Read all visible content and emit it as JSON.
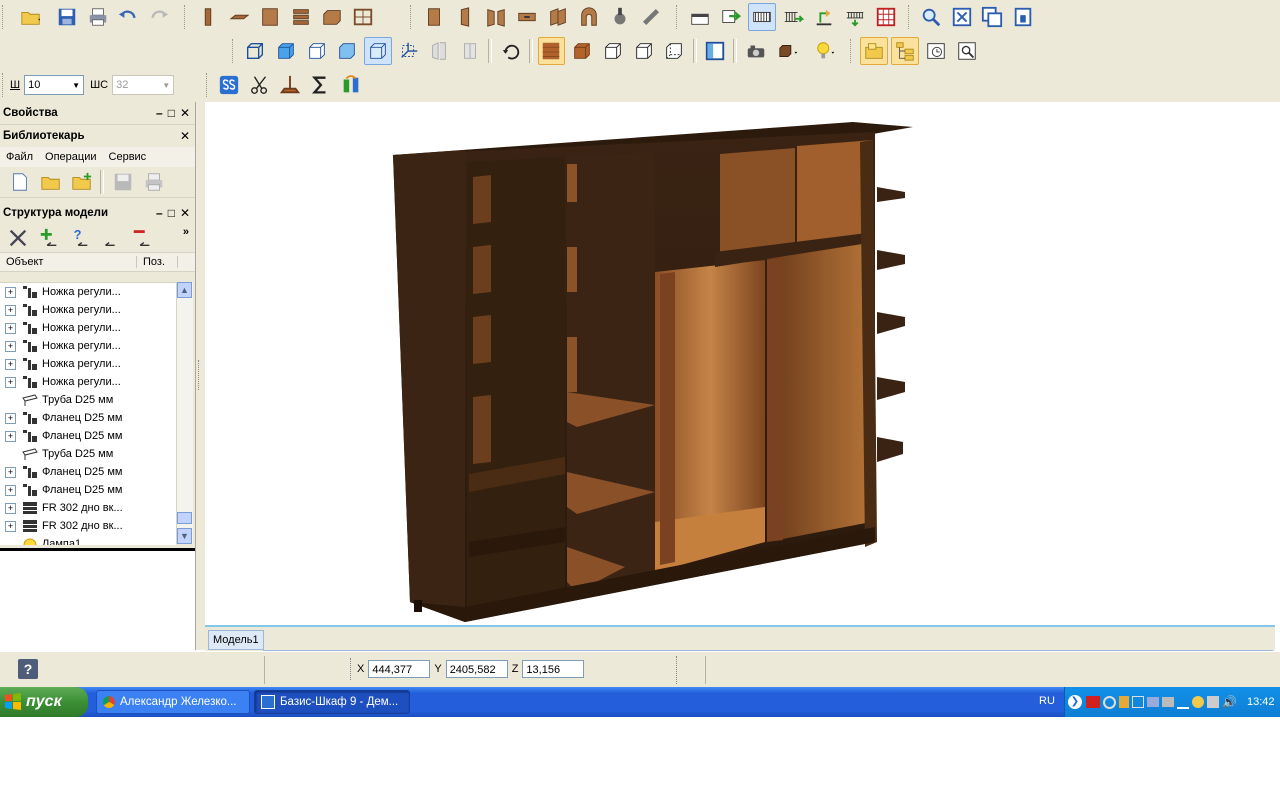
{
  "toolbar": {
    "width_label": "Ш",
    "width_value": "10",
    "depth_label": "ШС",
    "depth_value": "32"
  },
  "panels": {
    "properties_title": "Свойства",
    "librarian_title": "Библиотекарь",
    "librarian_menu": [
      "Файл",
      "Операции",
      "Сервис"
    ],
    "structure_title": "Структура модели",
    "columns": {
      "object": "Объект",
      "pos": "Поз."
    },
    "tree_items": [
      {
        "label": "Ножка регули...",
        "icon": "leg-icon",
        "expand": true
      },
      {
        "label": "Ножка регули...",
        "icon": "leg-icon",
        "expand": true
      },
      {
        "label": "Ножка регули...",
        "icon": "leg-icon",
        "expand": true
      },
      {
        "label": "Ножка регули...",
        "icon": "leg-icon",
        "expand": true
      },
      {
        "label": "Ножка регули...",
        "icon": "leg-icon",
        "expand": true
      },
      {
        "label": "Ножка регули...",
        "icon": "leg-icon",
        "expand": true
      },
      {
        "label": "Труба D25 мм",
        "icon": "pipe-icon",
        "expand": false
      },
      {
        "label": "Фланец D25 мм",
        "icon": "flange-icon",
        "expand": true
      },
      {
        "label": "Фланец D25 мм",
        "icon": "flange-icon",
        "expand": true
      },
      {
        "label": "Труба D25 мм",
        "icon": "pipe-icon",
        "expand": false
      },
      {
        "label": "Фланец D25 мм",
        "icon": "flange-icon",
        "expand": true
      },
      {
        "label": "Фланец D25 мм",
        "icon": "flange-icon",
        "expand": true
      },
      {
        "label": "FR 302 дно вк...",
        "icon": "drawer-icon",
        "expand": true
      },
      {
        "label": "FR 302 дно вк...",
        "icon": "drawer-icon",
        "expand": true
      },
      {
        "label": "Лампа1",
        "icon": "lamp-icon",
        "expand": false
      }
    ]
  },
  "viewport": {
    "tab_label": "Модель1"
  },
  "status": {
    "x_label": "X",
    "x_value": "444,377",
    "y_label": "Y",
    "y_value": "2405,582",
    "z_label": "Z",
    "z_value": "13,156"
  },
  "taskbar": {
    "start_label": "пуск",
    "tasks": [
      "Александр Железко...",
      "Базис-Шкаф 9 - Дем..."
    ],
    "lang": "RU",
    "clock": "13:42"
  },
  "colors": {
    "wood_dark": "#3a2313",
    "wood_light": "#a96a36",
    "taskbar": "#245edb",
    "start": "#3c8f35"
  }
}
